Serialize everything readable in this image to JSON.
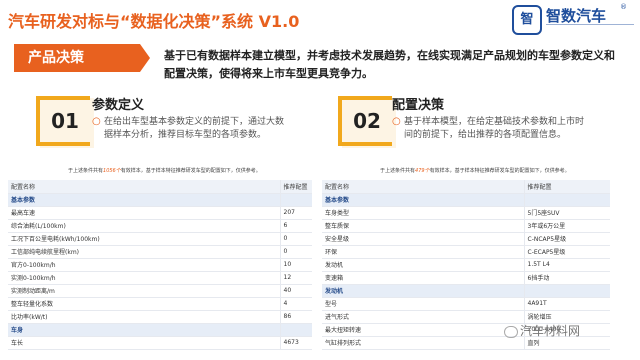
{
  "header": {
    "title": "汽车研发对标与“数据化决策”系统 V1.0",
    "logo_name": "智数汽车",
    "logo_mark": "智",
    "logo_reg": "®"
  },
  "banner": {
    "label": "产品决策"
  },
  "intro": "基于已有数据样本建立模型，并考虑技术发展趋势，在线实现满足产品规划的车型参数定义和配置决策，使得将来上市车型更具竞争力。",
  "sections": [
    {
      "number": "01",
      "title": "参数定义",
      "bullet": "○",
      "desc": "在给出车型基本参数定义的前提下，通过大数据样本分析，推荐目标车型的各项参数。"
    },
    {
      "number": "02",
      "title": "配置决策",
      "bullet": "○",
      "desc": "基于样本模型，在给定基础技术参数和上市时间的前提下，给出推荐的各项配置信息。"
    }
  ],
  "left_table": {
    "caption_pre": "于上述条件共有",
    "caption_count": "1056个",
    "caption_post": "有效样本，基于样本特征推荐研发车型的配置如下，仅供参考。",
    "header": [
      "配置名称",
      "推荐配置"
    ],
    "rows": [
      {
        "type": "group",
        "cells": [
          "基本参数",
          ""
        ]
      },
      {
        "type": "row",
        "cells": [
          "最高车速",
          "207"
        ]
      },
      {
        "type": "row",
        "cells": [
          "综合油耗(L/100km)",
          "6"
        ]
      },
      {
        "type": "row",
        "cells": [
          "工况下百公里电耗(kWh/100km)",
          "0"
        ]
      },
      {
        "type": "row",
        "cells": [
          "工信部纯电续航里程(km)",
          "0"
        ]
      },
      {
        "type": "row",
        "cells": [
          "官方0-100km/h",
          "10"
        ]
      },
      {
        "type": "row",
        "cells": [
          "实测0-100km/h",
          "12"
        ]
      },
      {
        "type": "row",
        "cells": [
          "实测制动距离/m",
          "40"
        ]
      },
      {
        "type": "row",
        "cells": [
          "整车轻量化系数",
          "4"
        ]
      },
      {
        "type": "row",
        "cells": [
          "比功率(kW/t)",
          "86"
        ]
      },
      {
        "type": "group",
        "cells": [
          "车身",
          ""
        ]
      },
      {
        "type": "row",
        "cells": [
          "车长",
          "4673"
        ]
      }
    ]
  },
  "right_table": {
    "caption_pre": "于上述条件共有",
    "caption_count": "479个",
    "caption_post": "有效样本，基于样本特征推荐研发车型的配置如下，仅供参考。",
    "header": [
      "配置名称",
      "推荐配置"
    ],
    "rows": [
      {
        "type": "group",
        "cells": [
          "基本参数",
          ""
        ]
      },
      {
        "type": "row",
        "cells": [
          "车身类型",
          "5门5座SUV"
        ]
      },
      {
        "type": "row",
        "cells": [
          "整车质保",
          "3年或6万公里"
        ]
      },
      {
        "type": "row",
        "cells": [
          "安全星级",
          "C-NCAP5星级"
        ]
      },
      {
        "type": "row",
        "cells": [
          "环保",
          "C-ECAP5星级"
        ]
      },
      {
        "type": "row",
        "cells": [
          "发动机",
          "1.5T L4"
        ]
      },
      {
        "type": "row",
        "cells": [
          "变速箱",
          "6挡手动"
        ]
      },
      {
        "type": "group",
        "cells": [
          "发动机",
          ""
        ]
      },
      {
        "type": "row",
        "cells": [
          "型号",
          "4A91T"
        ]
      },
      {
        "type": "row",
        "cells": [
          "进气形式",
          "涡轮增压"
        ]
      },
      {
        "type": "row",
        "cells": [
          "最大扭矩转速",
          "2000-4400"
        ]
      },
      {
        "type": "row",
        "cells": [
          "气缸排列形式",
          "直列"
        ]
      }
    ]
  },
  "watermark": "汽车材料网"
}
